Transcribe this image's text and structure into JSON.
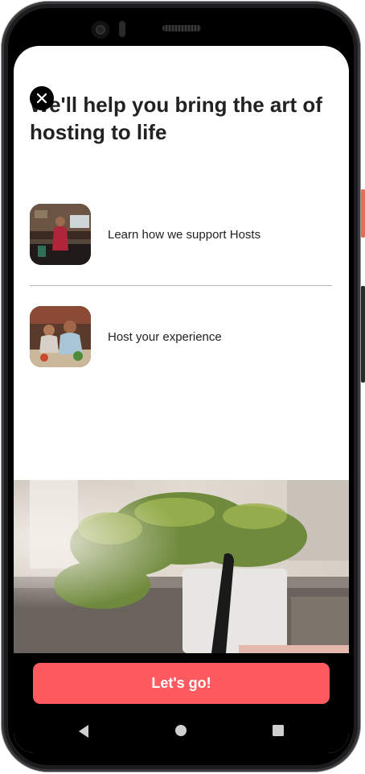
{
  "screen": {
    "headline": "We'll help you bring the art of hosting to life",
    "items": [
      {
        "label": "Learn how we support Hosts",
        "thumb": "kitchen-photo-thumbnail"
      },
      {
        "label": "Host your experience",
        "thumb": "cooking-class-photo-thumbnail"
      }
    ],
    "cta_label": "Let's go!",
    "close_icon": "close-icon"
  },
  "colors": {
    "accent": "#ff5a5f",
    "text": "#222222",
    "divider": "#b8b8b8"
  },
  "system_nav": [
    "back-icon",
    "home-icon",
    "recents-icon"
  ]
}
